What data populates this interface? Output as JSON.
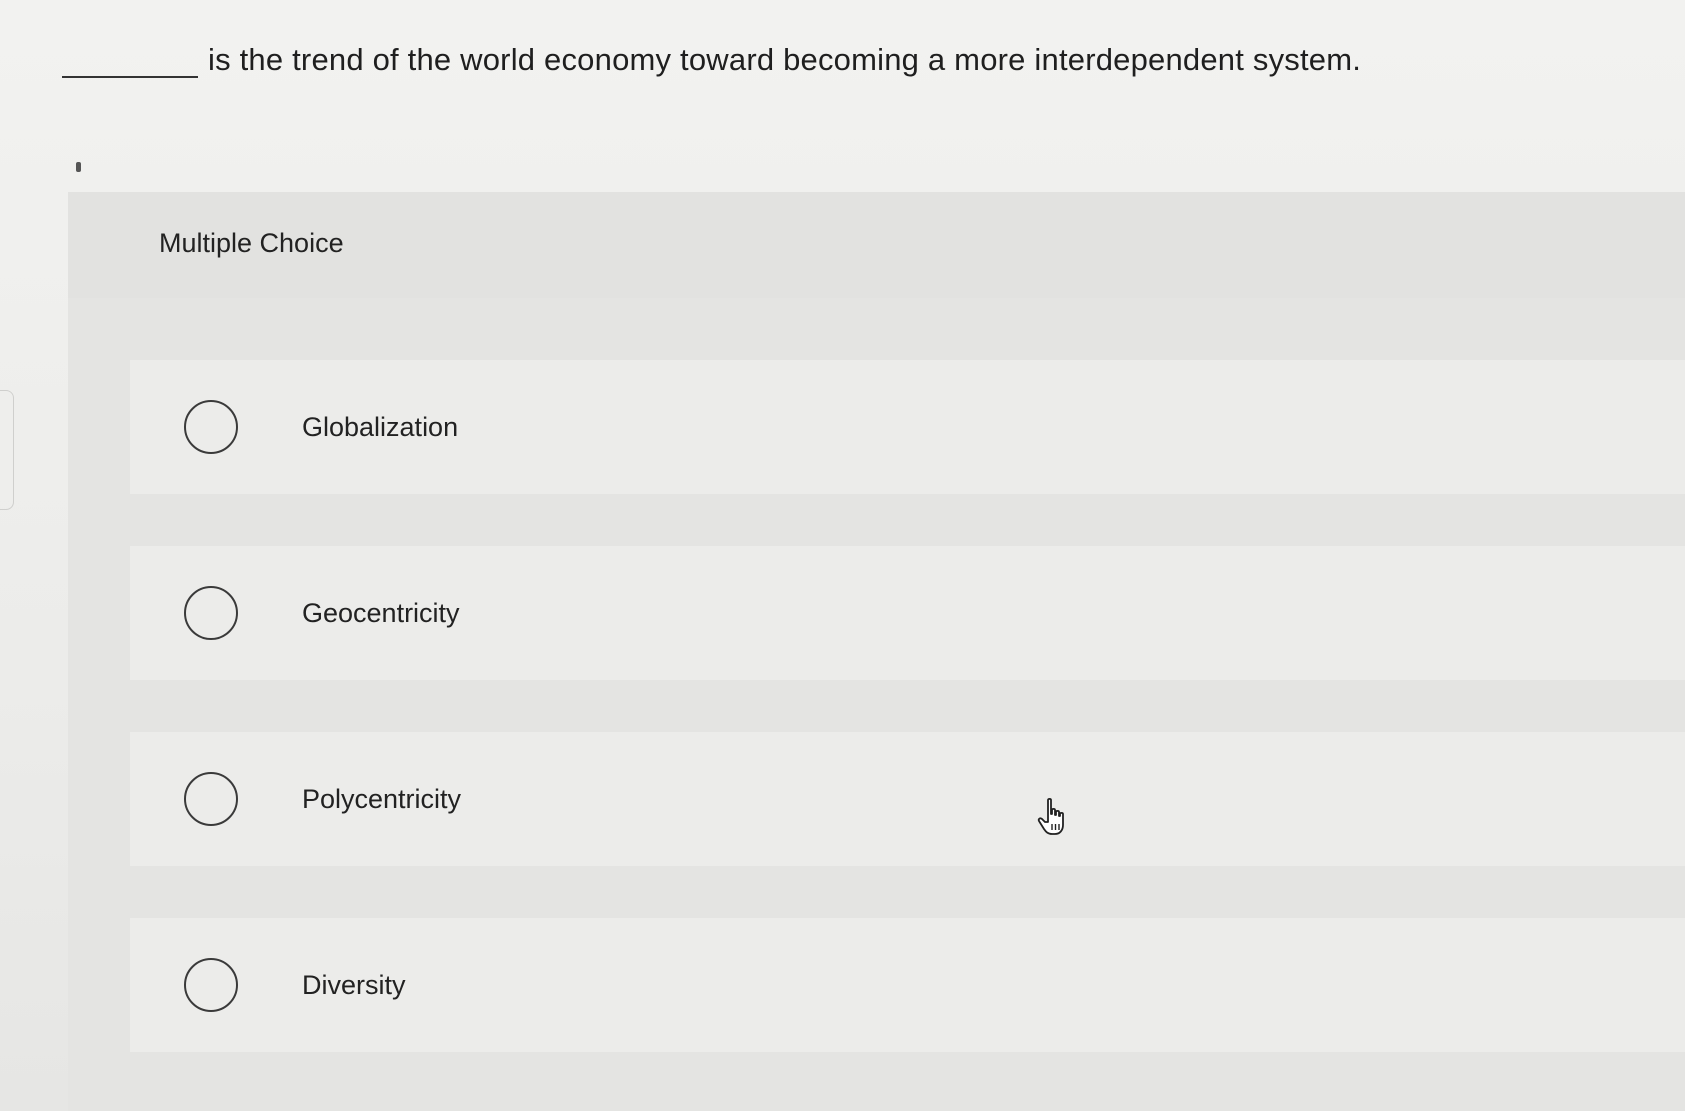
{
  "question": {
    "text": "is the trend of the world economy toward becoming a more interdependent system."
  },
  "panel": {
    "title": "Multiple Choice"
  },
  "options": [
    {
      "label": "Globalization",
      "selected": false
    },
    {
      "label": "Geocentricity",
      "selected": false
    },
    {
      "label": "Polycentricity",
      "selected": false
    },
    {
      "label": "Diversity",
      "selected": false
    }
  ],
  "cursor": {
    "icon": "hand-pointer-icon"
  }
}
